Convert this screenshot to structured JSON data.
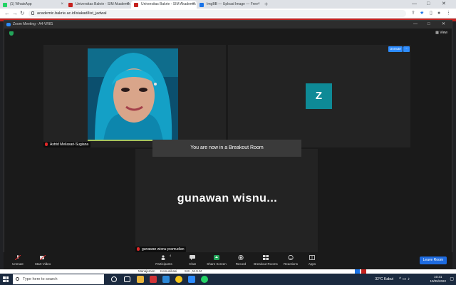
{
  "browser": {
    "tabs": [
      {
        "label": "(1) WhatsApp",
        "color": "#25d366"
      },
      {
        "label": "Universitas Bakrie - SIM Akademik",
        "color": "#c5221f"
      },
      {
        "label": "Universitas Bakrie - SIM Akademik",
        "color": "#c5221f"
      },
      {
        "label": "ImgBB — Upload Image — Free",
        "color": "#1a73e8"
      }
    ],
    "new_tab": "+",
    "url": "academic.bakrie.ac.id/siakad/list_jadwal"
  },
  "zoom": {
    "window_title": "Zoom Meeting - A4-VR81",
    "view_label": "View",
    "participants": [
      {
        "name": "Astrid Meilasari-Sugiana"
      },
      {
        "name": "Z",
        "initial": "Z",
        "unmute_label": "Unmute",
        "more_label": "···"
      },
      {
        "name": "gunawan wisnu pramudian",
        "display_name": "gunawan  wisnu..."
      }
    ],
    "notice": "You are now in a Breakout Room",
    "toolbar": {
      "unmute": "Unmute",
      "start_video": "Start Video",
      "participants": "Participants",
      "participants_count": "4",
      "chat": "Chat",
      "share_screen": "Share Screen",
      "record": "Record",
      "breakout_rooms": "Breakout Rooms",
      "reactions": "Reactions",
      "apps": "Apps",
      "leave": "Leave Room"
    },
    "colors": {
      "accent": "#2d8cff",
      "share": "#23a55a",
      "leave": "#1e6be0",
      "avatar": "#0e8a96"
    }
  },
  "page_row": [
    "Manajemen",
    "Komunikasi",
    "S.E., M.S.M"
  ],
  "taskbar": {
    "search_placeholder": "Type here to search",
    "weather": "32°C  Kabut",
    "time": "10:31",
    "date": "10/05/2022"
  }
}
